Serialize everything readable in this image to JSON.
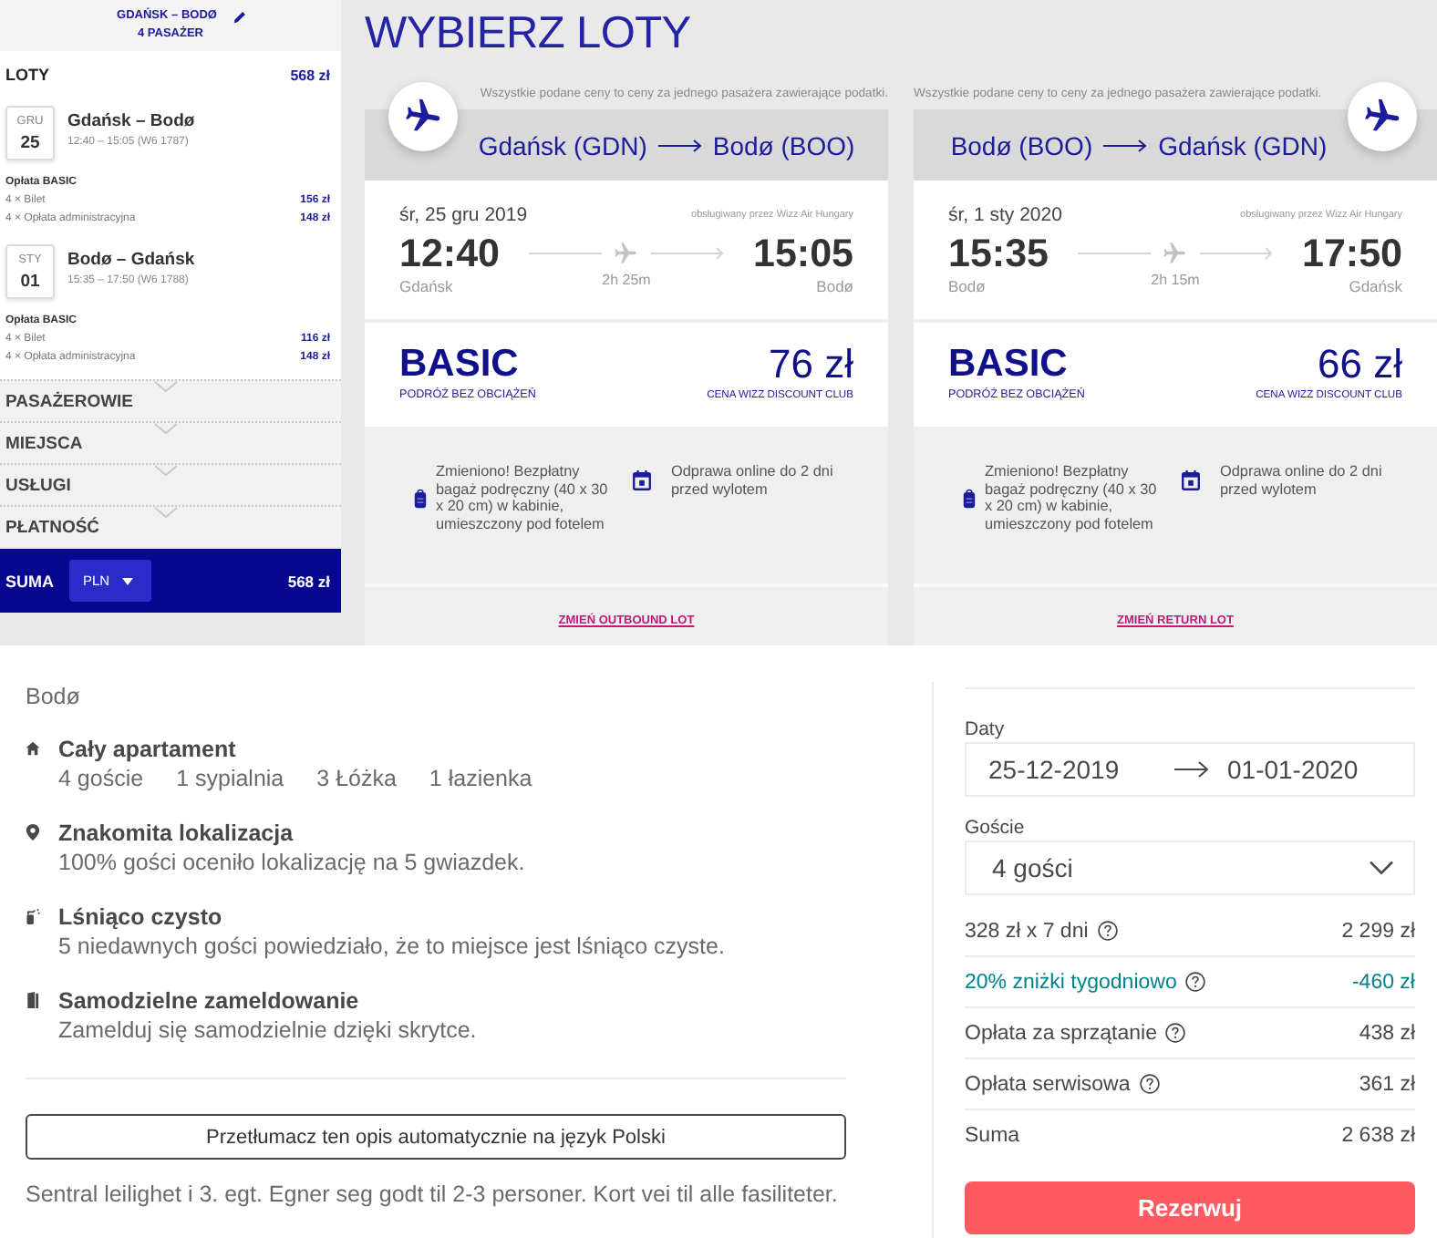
{
  "sidebar": {
    "route": "GDAŃSK – BODØ",
    "passengers": "4 PASAŻER",
    "flights_title": "LOTY",
    "flights_total": "568 zł",
    "flights": [
      {
        "month": "GRU",
        "day": "25",
        "route": "Gdańsk – Bodø",
        "schedule": "12:40 – 15:05 (W6 1787)",
        "fare": "Opłata BASIC",
        "charges": [
          {
            "label": "4 × Bilet",
            "amount": "156 zł"
          },
          {
            "label": "4 × Opłata administracyjna",
            "amount": "148 zł"
          }
        ]
      },
      {
        "month": "STY",
        "day": "01",
        "route": "Bodø – Gdańsk",
        "schedule": "15:35 – 17:50 (W6 1788)",
        "fare": "Opłata BASIC",
        "charges": [
          {
            "label": "4 × Bilet",
            "amount": "116 zł"
          },
          {
            "label": "4 × Opłata administracyjna",
            "amount": "148 zł"
          }
        ]
      }
    ],
    "sections": [
      "PASAŻEROWIE",
      "MIEJSCA",
      "USŁUGI",
      "PŁATNOŚĆ"
    ],
    "total": {
      "label": "SUMA",
      "currency": "PLN",
      "amount": "568 zł"
    }
  },
  "page_title": "WYBIERZ LOTY",
  "flight_cards": [
    {
      "kind": "outbound",
      "disclaimer": "Wszystkie podane ceny to ceny za jednego pasażera zawierające podatki.",
      "origin": "Gdańsk (GDN)",
      "destination": "Bodø (BOO)",
      "date": "śr, 25 gru 2019",
      "operator": "obsługiwany przez Wizz Air Hungary",
      "departure_time": "12:40",
      "arrival_time": "15:05",
      "duration": "2h 25m",
      "departure_city": "Gdańsk",
      "arrival_city": "Bodø",
      "fare": "BASIC",
      "fare_note": "PODRÓŻ BEZ OBCIĄŻEŃ",
      "price": "76 zł",
      "price_note": "CENA WIZZ DISCOUNT CLUB",
      "features": [
        {
          "kind": "baggage",
          "text": "Zmieniono! Bezpłatny bagaż podręczny (40 x 30 x 20 cm) w kabinie, umieszczony pod fotelem"
        },
        {
          "kind": "check-in",
          "text": "Odprawa online do 2 dni przed wylotem"
        }
      ],
      "change_link": "ZMIEŃ OUTBOUND LOT"
    },
    {
      "kind": "return",
      "disclaimer": "Wszystkie podane ceny to ceny za jednego pasażera zawierające podatki.",
      "origin": "Bodø (BOO)",
      "destination": "Gdańsk (GDN)",
      "date": "śr, 1 sty 2020",
      "operator": "obsługiwany przez Wizz Air Hungary",
      "departure_time": "15:35",
      "arrival_time": "17:50",
      "duration": "2h 15m",
      "departure_city": "Bodø",
      "arrival_city": "Gdańsk",
      "fare": "BASIC",
      "fare_note": "PODRÓŻ BEZ OBCIĄŻEŃ",
      "price": "66 zł",
      "price_note": "CENA WIZZ DISCOUNT CLUB",
      "features": [
        {
          "kind": "baggage",
          "text": "Zmieniono! Bezpłatny bagaż podręczny (40 x 30 x 20 cm) w kabinie, umieszczony pod fotelem"
        },
        {
          "kind": "check-in",
          "text": "Odprawa online do 2 dni przed wylotem"
        }
      ],
      "change_link": "ZMIEŃ RETURN LOT"
    }
  ],
  "listing": {
    "location": "Bodø",
    "highlights": [
      {
        "kind": "home",
        "title": "Cały apartament",
        "details": [
          "4 goście",
          "1 sypialnia",
          "3 Łóżka",
          "1 łazienka"
        ]
      },
      {
        "kind": "location",
        "title": "Znakomita lokalizacja",
        "text": "100% gości oceniło lokalizację na 5 gwiazdek."
      },
      {
        "kind": "clean",
        "title": "Lśniąco czysto",
        "text": "5 niedawnych gości powiedziało, że to miejsce jest lśniąco czyste."
      },
      {
        "kind": "self-check-in",
        "title": "Samodzielne zameldowanie",
        "text": "Zamelduj się samodzielnie dzięki skrytce."
      }
    ],
    "translate_button": "Przetłumacz ten opis automatycznie na język Polski",
    "description": "Sentral leilighet i 3. egt. Egner seg godt til 2-3 personer. Kort vei til alle fasiliteter."
  },
  "booking": {
    "dates_label": "Daty",
    "check_in": "25-12-2019",
    "check_out": "01-01-2020",
    "guests_label": "Goście",
    "guests": "4 gości",
    "lines": [
      {
        "kind": "charge",
        "label": "328 zł x 7 dni",
        "help": true,
        "amount": "2 299 zł"
      },
      {
        "kind": "discount",
        "label": "20% zniżki tygodniowo",
        "help": true,
        "amount": "-460 zł"
      },
      {
        "kind": "charge",
        "label": "Opłata za sprzątanie",
        "help": true,
        "amount": "438 zł"
      },
      {
        "kind": "charge",
        "label": "Opłata serwisowa",
        "help": true,
        "amount": "361 zł"
      },
      {
        "kind": "total",
        "label": "Suma",
        "help": false,
        "amount": "2 638 zł"
      }
    ],
    "reserve_button": "Rezerwuj"
  }
}
